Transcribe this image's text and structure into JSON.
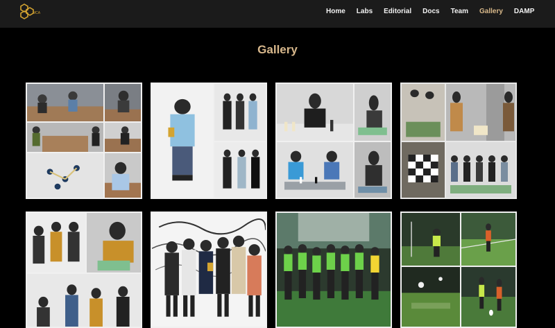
{
  "brand": {
    "logo_text": "MCA",
    "logo_color": "#d4a431"
  },
  "nav": {
    "items": [
      {
        "label": "Home",
        "active": false
      },
      {
        "label": "Labs",
        "active": false
      },
      {
        "label": "Editorial",
        "active": false
      },
      {
        "label": "Docs",
        "active": false
      },
      {
        "label": "Team",
        "active": false
      },
      {
        "label": "Gallery",
        "active": true
      },
      {
        "label": "DAMP",
        "active": false
      }
    ]
  },
  "page": {
    "title": "Gallery"
  },
  "colors": {
    "accent": "#d8b88c",
    "navbar_bg": "#1b1b1b",
    "background": "#000000"
  },
  "gallery": {
    "tiles": [
      {
        "name": "carrom-collage"
      },
      {
        "name": "winners-collage"
      },
      {
        "name": "chess-collage"
      },
      {
        "name": "chess-event-collage"
      },
      {
        "name": "team-collage"
      },
      {
        "name": "group-photo"
      },
      {
        "name": "football-team-photo"
      },
      {
        "name": "football-match-collage"
      }
    ]
  }
}
